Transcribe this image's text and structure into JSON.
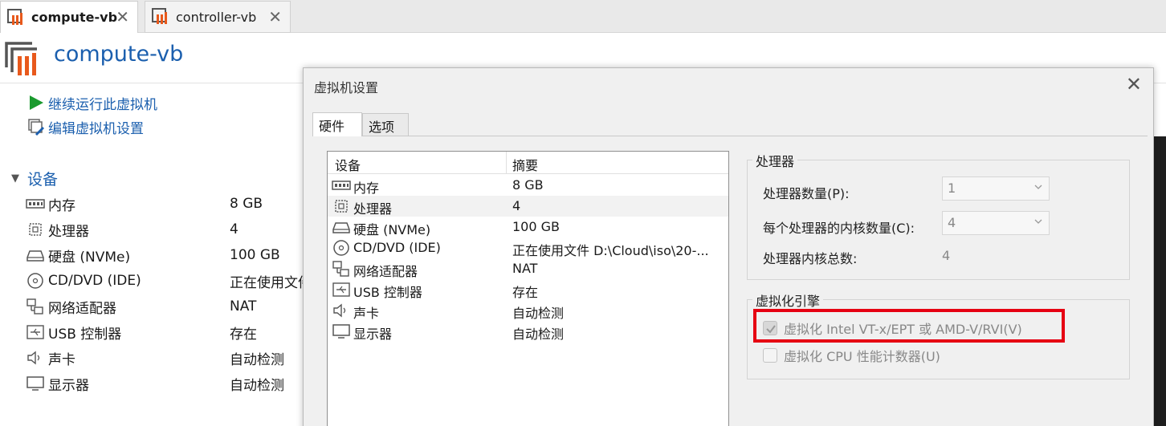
{
  "tabs": [
    {
      "label": "compute-vb",
      "active": true
    },
    {
      "label": "controller-vb",
      "active": false
    }
  ],
  "header": {
    "title": "compute-vb"
  },
  "actions": {
    "power_on": "继续运行此虚拟机",
    "edit_settings": "编辑虚拟机设置"
  },
  "devices": {
    "heading": "设备",
    "items": [
      {
        "label": "内存",
        "value": "8 GB",
        "icon": "memory-icon"
      },
      {
        "label": "处理器",
        "value": "4",
        "icon": "processor-icon"
      },
      {
        "label": "硬盘 (NVMe)",
        "value": "100 GB",
        "icon": "hard-disk-icon"
      },
      {
        "label": "CD/DVD (IDE)",
        "value": "正在使用文件",
        "icon": "cd-dvd-icon"
      },
      {
        "label": "网络适配器",
        "value": "NAT",
        "icon": "network-adapter-icon"
      },
      {
        "label": "USB 控制器",
        "value": "存在",
        "icon": "usb-icon"
      },
      {
        "label": "声卡",
        "value": "自动检测",
        "icon": "sound-card-icon"
      },
      {
        "label": "显示器",
        "value": "自动检测",
        "icon": "display-icon"
      }
    ]
  },
  "dialog": {
    "title": "虚拟机设置",
    "tabs": [
      "硬件",
      "选项"
    ],
    "hardware_list": {
      "col_device": "设备",
      "col_summary": "摘要",
      "rows": [
        {
          "device": "内存",
          "summary": "8 GB"
        },
        {
          "device": "处理器",
          "summary": "4",
          "selected": true
        },
        {
          "device": "硬盘 (NVMe)",
          "summary": "100 GB"
        },
        {
          "device": "CD/DVD (IDE)",
          "summary": "正在使用文件 D:\\Cloud\\iso\\20-..."
        },
        {
          "device": "网络适配器",
          "summary": "NAT"
        },
        {
          "device": "USB 控制器",
          "summary": "存在"
        },
        {
          "device": "声卡",
          "summary": "自动检测"
        },
        {
          "device": "显示器",
          "summary": "自动检测"
        }
      ]
    },
    "processors": {
      "group_label": "处理器",
      "count_label": "处理器数量(P):",
      "count_value": "1",
      "cores_label": "每个处理器的内核数量(C):",
      "cores_value": "4",
      "total_label": "处理器内核总数:",
      "total_value": "4"
    },
    "virtualization": {
      "group_label": "虚拟化引擎",
      "vtx_label": "虚拟化 Intel VT-x/EPT 或 AMD-V/RVI(V)",
      "vtx_checked": true,
      "cpu_counter_label": "虚拟化 CPU 性能计数器(U)",
      "cpu_counter_checked": false
    }
  },
  "colors": {
    "link_blue": "#1b5fae",
    "highlight_red": "#e60012",
    "play_green": "#1a9a2e",
    "vm_orange": "#e8591c"
  }
}
